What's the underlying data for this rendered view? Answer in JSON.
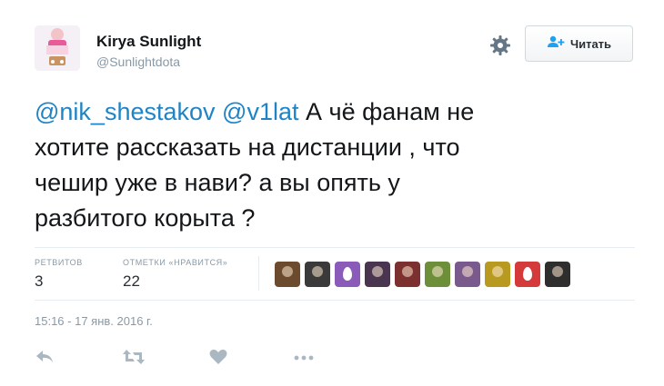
{
  "tweet": {
    "author": {
      "display_name": "Kirya Sunlight",
      "screen_name": "@Sunlightdota",
      "avatar_icon": "avatar-photo"
    },
    "follow_button": {
      "label": "Читать",
      "icon": "add-user-icon"
    },
    "settings_icon": "gear-icon",
    "text": {
      "mention_1": "@nik_shestakov",
      "mention_2": "@v1lat",
      "line_1_rest": " А чё фанам не",
      "line_2": "хотите рассказать на дистанции , что",
      "line_3": "чешир уже в нави? а вы опять у",
      "line_4": "разбитого корыта ?"
    },
    "stats": {
      "retweets_label": "РЕТВИТОВ",
      "retweets_value": "3",
      "likes_label": "ОТМЕТКИ «НРАВИТСЯ»",
      "likes_value": "22"
    },
    "likers": [
      {
        "kind": "photo",
        "color": "#6b4a2e"
      },
      {
        "kind": "photo",
        "color": "#3a3a3a"
      },
      {
        "kind": "egg",
        "color": "#8a5bb8"
      },
      {
        "kind": "photo",
        "color": "#4a3550"
      },
      {
        "kind": "photo",
        "color": "#7c3030"
      },
      {
        "kind": "photo",
        "color": "#6e8f3a"
      },
      {
        "kind": "photo",
        "color": "#7a5a8c"
      },
      {
        "kind": "photo",
        "color": "#b89a20"
      },
      {
        "kind": "egg",
        "color": "#d43a3a"
      },
      {
        "kind": "photo",
        "color": "#2e2e2e"
      }
    ],
    "timestamp": "15:16 - 17 янв. 2016 г.",
    "actions": [
      "reply-icon",
      "retweet-icon",
      "like-heart-icon",
      "more-icon"
    ],
    "colors": {
      "link": "#1f84c6",
      "muted": "#8899a6",
      "icon_gray": "#aab8c2",
      "divider": "#e6ecf0",
      "follow_icon_blue": "#1da1f2"
    }
  }
}
